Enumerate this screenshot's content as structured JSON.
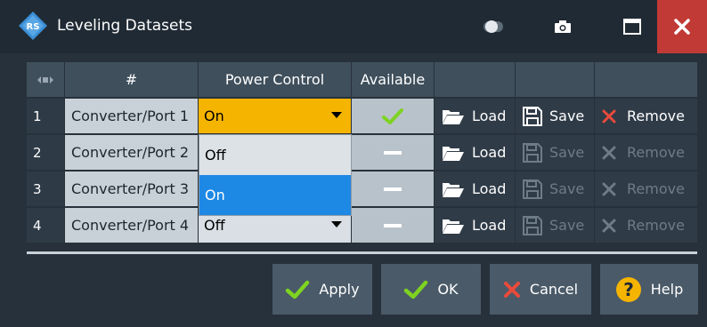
{
  "window": {
    "title": "Leveling Datasets",
    "icons": {
      "logo": "rs-logo-icon",
      "toggle": "toggle-icon",
      "camera": "camera-icon",
      "maximize": "maximize-icon",
      "close": "close-icon"
    }
  },
  "table": {
    "headers": {
      "nav": "",
      "index": "#",
      "power_control": "Power Control",
      "available": "Available"
    },
    "rows": [
      {
        "index": "1",
        "name": "Converter/Port 1",
        "power_control": "On",
        "available": "check",
        "load": "Load",
        "save": "Save",
        "remove": "Remove",
        "save_enabled": true
      },
      {
        "index": "2",
        "name": "Converter/Port 2",
        "power_control": "",
        "available": "dash",
        "load": "Load",
        "save": "Save",
        "remove": "Remove",
        "save_enabled": false
      },
      {
        "index": "3",
        "name": "Converter/Port 3",
        "power_control": "",
        "available": "dash",
        "load": "Load",
        "save": "Save",
        "remove": "Remove",
        "save_enabled": false
      },
      {
        "index": "4",
        "name": "Converter/Port 4",
        "power_control": "Off",
        "available": "dash",
        "load": "Load",
        "save": "Save",
        "remove": "Remove",
        "save_enabled": false
      }
    ]
  },
  "dropdown": {
    "options": [
      "Off",
      "On"
    ],
    "selected": "On"
  },
  "buttons": {
    "apply": "Apply",
    "ok": "OK",
    "cancel": "Cancel",
    "help": "Help"
  },
  "colors": {
    "accent_yellow": "#f5b400",
    "selection_blue": "#1e88e5",
    "check_green": "#7ed321",
    "close_red": "#c13a36"
  }
}
